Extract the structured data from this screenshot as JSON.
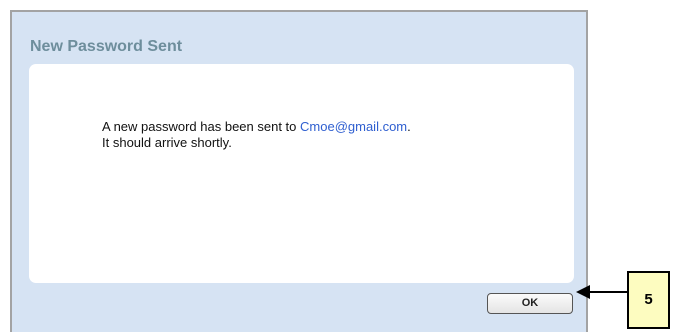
{
  "dialog": {
    "title": "New Password Sent",
    "message_prefix": "A new password has been sent to ",
    "email": "Cmoe@gmail.com",
    "message_suffix": ".",
    "message_line2": "It should arrive shortly.",
    "ok_label": "OK"
  },
  "annotation": {
    "callout_number": "5",
    "arrow_icon": "left-arrow-icon"
  },
  "colors": {
    "dialog_background": "#d6e3f3",
    "title": "#6e8e9c",
    "email_link": "#2f5fd0",
    "callout_background": "#fdfcc0"
  }
}
